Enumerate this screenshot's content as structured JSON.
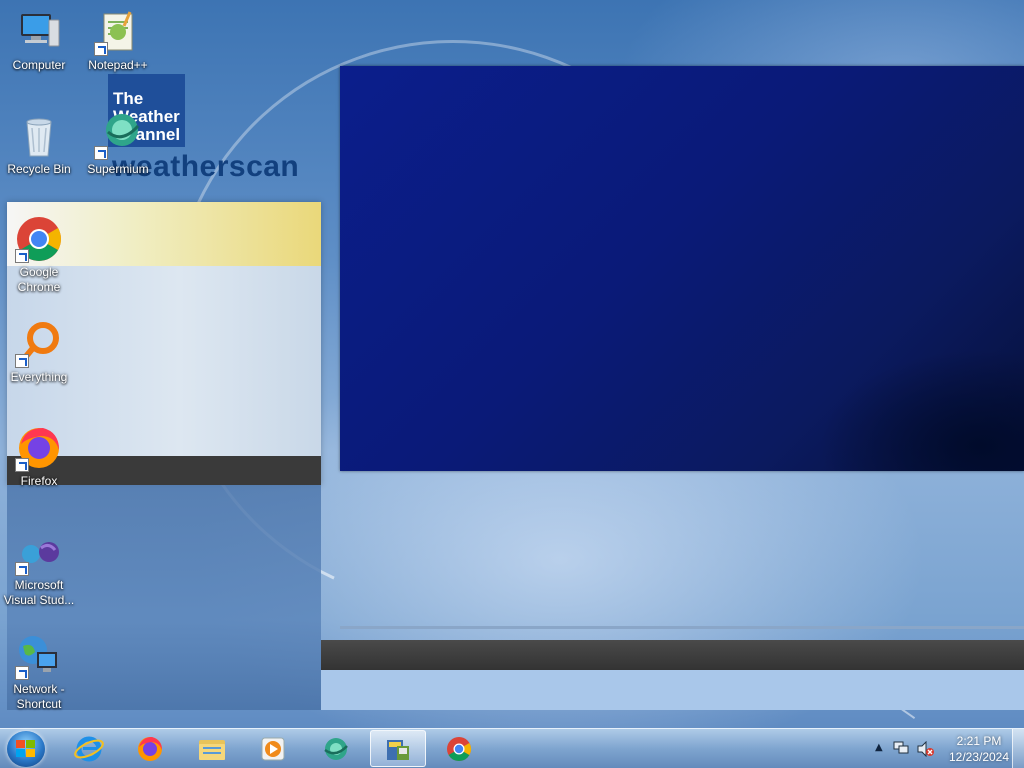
{
  "desktop": {
    "icons": [
      {
        "id": "computer",
        "label": "Computer",
        "icon": "computer-icon"
      },
      {
        "id": "notepadpp",
        "label": "Notepad++",
        "icon": "notepadpp-icon"
      },
      {
        "id": "recycle-bin",
        "label": "Recycle Bin",
        "icon": "recycle-bin-icon"
      },
      {
        "id": "supermium",
        "label": "Supermium",
        "icon": "supermium-icon"
      },
      {
        "id": "google-chrome",
        "label_line1": "Google",
        "label_line2": "Chrome",
        "icon": "chrome-icon"
      },
      {
        "id": "everything",
        "label": "Everything",
        "icon": "everything-icon"
      },
      {
        "id": "firefox",
        "label": "Firefox",
        "icon": "firefox-icon"
      },
      {
        "id": "vs",
        "label_line1": "Microsoft",
        "label_line2": "Visual Stud...",
        "icon": "visual-studio-icon"
      },
      {
        "id": "network",
        "label_line1": "Network -",
        "label_line2": "Shortcut",
        "icon": "network-icon"
      }
    ]
  },
  "weatherscan": {
    "logo_line1": "The",
    "logo_line2": "Weather",
    "logo_line3": "Channel",
    "brand": "weatherscan"
  },
  "taskbar": {
    "pinned": [
      {
        "name": "internet-explorer",
        "icon": "internet-explorer-icon"
      },
      {
        "name": "firefox",
        "icon": "firefox-icon"
      },
      {
        "name": "file-explorer",
        "icon": "folder-icon"
      },
      {
        "name": "media-player",
        "icon": "media-player-icon"
      },
      {
        "name": "supermium",
        "icon": "supermium-icon"
      },
      {
        "name": "weatherscan-app",
        "icon": "weatherscan-app-icon",
        "active": true
      },
      {
        "name": "chrome",
        "icon": "chrome-icon"
      }
    ],
    "clock": {
      "time": "2:21 PM",
      "date": "12/23/2024"
    },
    "tray_chevron": "▲"
  },
  "colors": {
    "screen_blue": "#0b1e8c",
    "ticker_dark": "#3a3a3a",
    "ticker_light": "#a9c7ea",
    "logo_blue": "#1f4f9a"
  }
}
